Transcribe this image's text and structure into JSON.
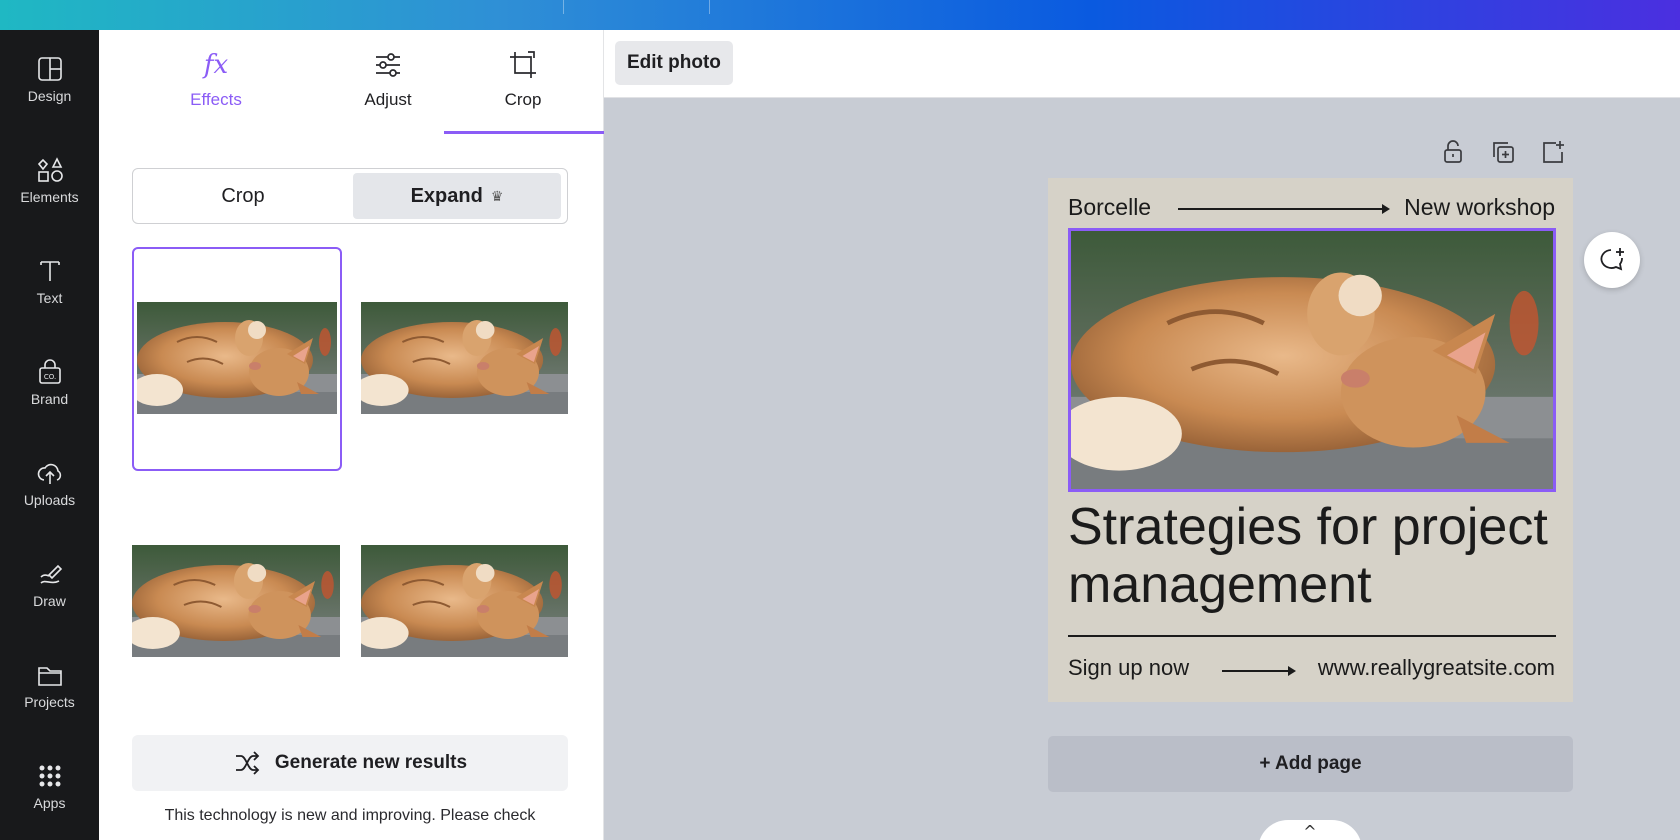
{
  "sidebar": {
    "items": [
      {
        "label": "Design",
        "icon": "design-icon"
      },
      {
        "label": "Elements",
        "icon": "elements-icon"
      },
      {
        "label": "Text",
        "icon": "text-icon"
      },
      {
        "label": "Brand",
        "icon": "brand-icon"
      },
      {
        "label": "Uploads",
        "icon": "upload-cloud-icon"
      },
      {
        "label": "Draw",
        "icon": "draw-icon"
      },
      {
        "label": "Projects",
        "icon": "folder-icon"
      },
      {
        "label": "Apps",
        "icon": "apps-grid-icon"
      }
    ]
  },
  "panel": {
    "tabs": [
      {
        "label": "Effects",
        "icon": "fx-icon"
      },
      {
        "label": "Adjust",
        "icon": "sliders-icon"
      },
      {
        "label": "Crop",
        "icon": "crop-icon",
        "active": true
      }
    ],
    "segmented": {
      "crop_label": "Crop",
      "expand_label": "Expand",
      "expand_badge": "♛",
      "selected": "Expand"
    },
    "generate_label": "Generate new results",
    "disclaimer": "This technology is new and improving. Please check"
  },
  "toolbar": {
    "edit_photo_label": "Edit photo"
  },
  "design": {
    "brand": "Borcelle",
    "event": "New workshop",
    "headline": "Strategies for project management",
    "cta": "Sign up now",
    "website": "www.reallygreatsite.com"
  },
  "canvas": {
    "add_page_label": "+ Add page",
    "collapse_label": "^"
  },
  "colors": {
    "accent": "#8b5cf6",
    "sidebar_bg": "#18191b",
    "canvas_bg": "#c8ccd4",
    "page_bg": "#d6d2c8"
  }
}
